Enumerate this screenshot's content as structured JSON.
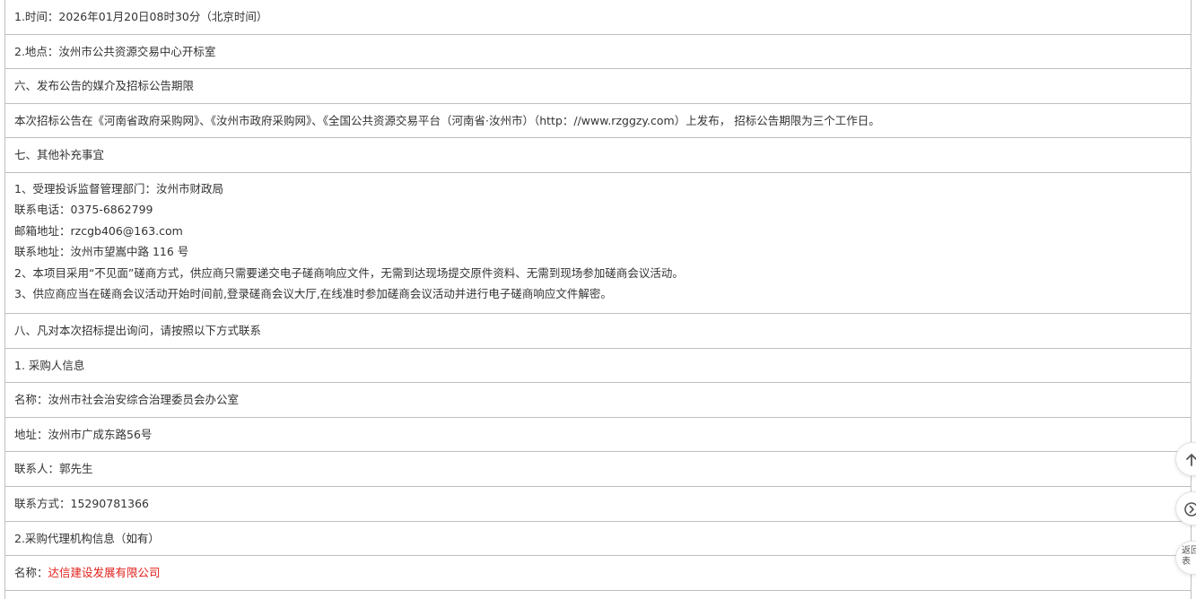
{
  "rows": [
    {
      "text": "1.时间：2026年01月20日08时30分（北京时间）"
    },
    {
      "text": "2.地点：汝州市公共资源交易中心开标室"
    },
    {
      "text": "六、发布公告的媒介及招标公告期限"
    },
    {
      "text": "本次招标公告在《河南省政府采购网》、《汝州市政府采购网》、《全国公共资源交易平台（河南省·汝州市）（http：//www.rzggzy.com）上发布， 招标公告期限为三个工作日。"
    },
    {
      "text": "七、其他补充事宜"
    },
    {
      "lines": [
        "1、受理投诉监督管理部门：汝州市财政局",
        "联系电话：0375-6862799",
        "邮箱地址：rzcgb406@163.com",
        "联系地址：汝州市望嵩中路 116 号",
        "2、本项目采用“不见面”磋商方式，供应商只需要递交电子磋商响应文件，无需到达现场提交原件资料、无需到现场参加磋商会议活动。",
        "3、供应商应当在磋商会议活动开始时间前,登录磋商会议大厅,在线准时参加磋商会议活动并进行电子磋商响应文件解密。"
      ]
    },
    {
      "text": "八、凡对本次招标提出询问，请按照以下方式联系"
    },
    {
      "text": "1. 采购人信息"
    },
    {
      "text": "名称：汝州市社会治安综合治理委员会办公室"
    },
    {
      "text": "地址：汝州市广成东路56号"
    },
    {
      "text": "联系人：郭先生"
    },
    {
      "text": "联系方式：15290781366"
    },
    {
      "text": "2.采购代理机构信息（如有）"
    },
    {
      "label": "名称：",
      "value": "达信建设发展有限公司",
      "value_color": "#e0201a"
    }
  ],
  "float_buttons": {
    "top_icon": "arrow-up-icon",
    "next_icon": "chevron-right-circle-icon",
    "return_label": "返回列表"
  }
}
